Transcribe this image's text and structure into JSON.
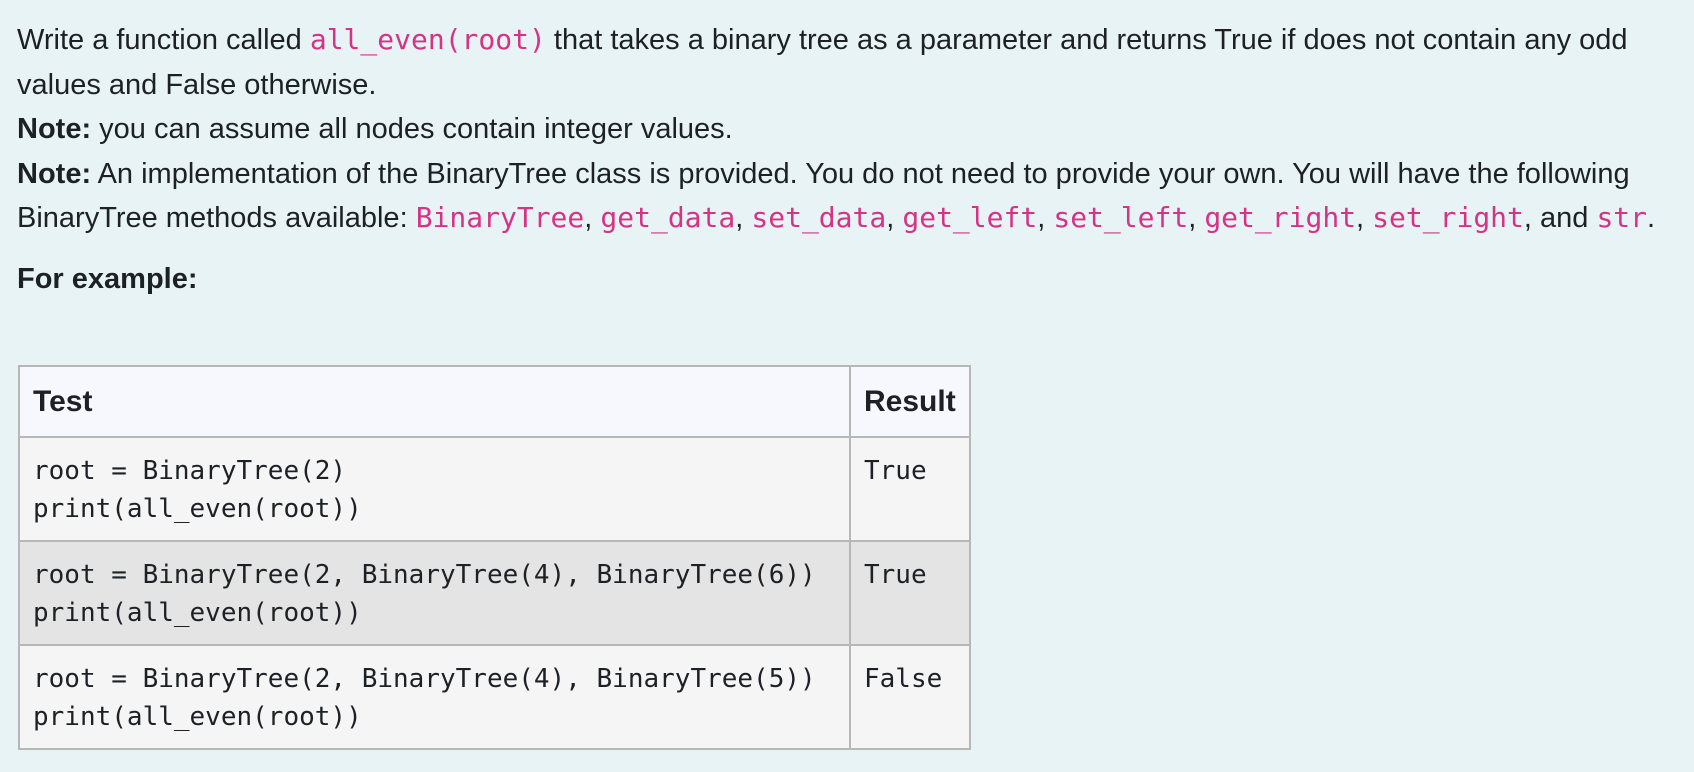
{
  "question": {
    "line1_pre": "Write a function called ",
    "function_signature": "all_even(root)",
    "line1_post": " that takes a binary tree as a parameter and returns True if does not contain any odd values and False otherwise.",
    "note1_label": "Note:",
    "note1_text": " you can assume all nodes contain integer values.",
    "note2_label": "Note:",
    "note2_text": " An implementation of the BinaryTree class is provided. You do not need to provide your own. You will have the following BinaryTree methods available: ",
    "methods": [
      "BinaryTree",
      "get_data",
      "set_data",
      "get_left",
      "set_left",
      "get_right",
      "set_right",
      "str"
    ],
    "separator": ", ",
    "and_text": ", and ",
    "period": ".",
    "example_heading": "For example:"
  },
  "examples_table": {
    "headers": [
      "Test",
      "Result"
    ],
    "rows": [
      {
        "test": "root = BinaryTree(2)\nprint(all_even(root))",
        "result": "True"
      },
      {
        "test": "root = BinaryTree(2, BinaryTree(4), BinaryTree(6))\nprint(all_even(root))",
        "result": "True"
      },
      {
        "test": "root = BinaryTree(2, BinaryTree(4), BinaryTree(5))\nprint(all_even(root))",
        "result": "False"
      }
    ]
  },
  "colors": {
    "background": "#e7f3f5",
    "code_text": "#d63384",
    "header_bg": "#f7f8fd",
    "row_odd_bg": "#f5f5f5",
    "row_even_bg": "#e4e4e4",
    "border": "#b7b7b7"
  }
}
